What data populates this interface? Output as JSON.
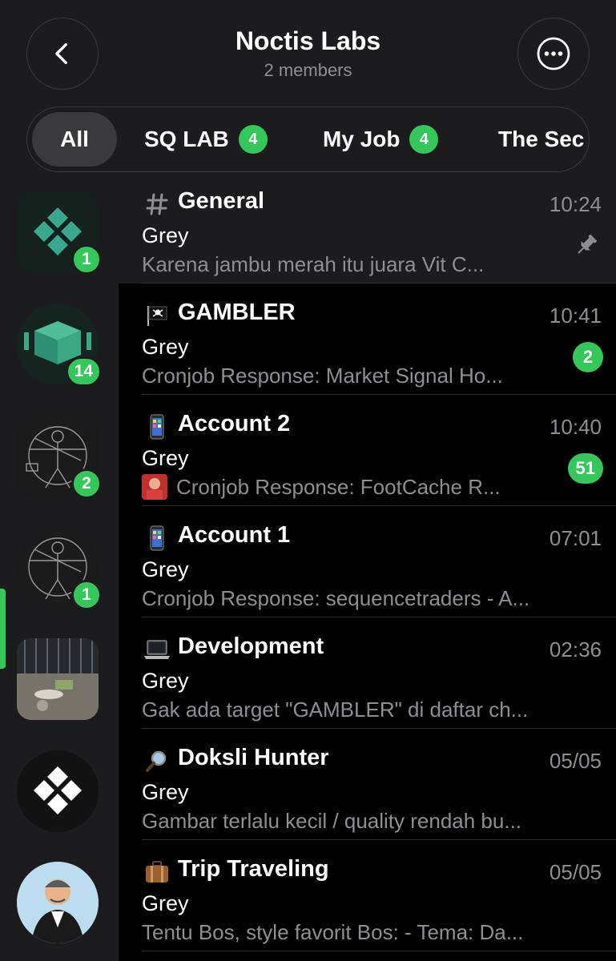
{
  "header": {
    "title": "Noctis Labs",
    "subtitle": "2 members",
    "back_icon": "chevron-left-icon",
    "more_icon": "ellipsis-icon"
  },
  "tabs": [
    {
      "label": "All",
      "selected": true
    },
    {
      "label": "SQ LAB",
      "badge": "4"
    },
    {
      "label": "My Job",
      "badge": "4"
    },
    {
      "label": "The Sec"
    }
  ],
  "rail": [
    {
      "badge": "1"
    },
    {
      "badge": "14"
    },
    {
      "badge": "2",
      "selected": true
    },
    {
      "badge": "1"
    },
    {},
    {},
    {}
  ],
  "topics": [
    {
      "icon": "hash-icon",
      "title": "General",
      "time": "10:24",
      "sender": "Grey",
      "preview": "Karena jambu merah itu juara Vit C...",
      "pinned": true
    },
    {
      "icon": "pirate-flag-icon",
      "title": "GAMBLER",
      "time": "10:41",
      "sender": "Grey",
      "preview": "Cronjob Response: Market Signal Ho...",
      "unread": "2"
    },
    {
      "icon": "phone-icon",
      "title": "Account 2",
      "time": "10:40",
      "sender": "Grey",
      "preview": "Cronjob Response: FootCache R...",
      "unread": "51",
      "thumbnail": true
    },
    {
      "icon": "phone-icon",
      "title": "Account 1",
      "time": "07:01",
      "sender": "Grey",
      "preview": "Cronjob Response: sequencetraders - A..."
    },
    {
      "icon": "laptop-icon",
      "title": "Development",
      "time": "02:36",
      "sender": "Grey",
      "preview": "Gak ada target \"GAMBLER\" di daftar ch..."
    },
    {
      "icon": "magnifier-icon",
      "title": "Doksli Hunter",
      "time": "05/05",
      "sender": "Grey",
      "preview": "Gambar terlalu kecil / quality rendah bu..."
    },
    {
      "icon": "luggage-icon",
      "title": "Trip Traveling",
      "time": "05/05",
      "sender": "Grey",
      "preview": "Tentu Bos, style favorit Bos: - Tema: Da..."
    }
  ],
  "colors": {
    "accent_green": "#34c759",
    "background": "#000000",
    "panel": "#1c1c1e",
    "secondary_text": "#8e8e93"
  }
}
